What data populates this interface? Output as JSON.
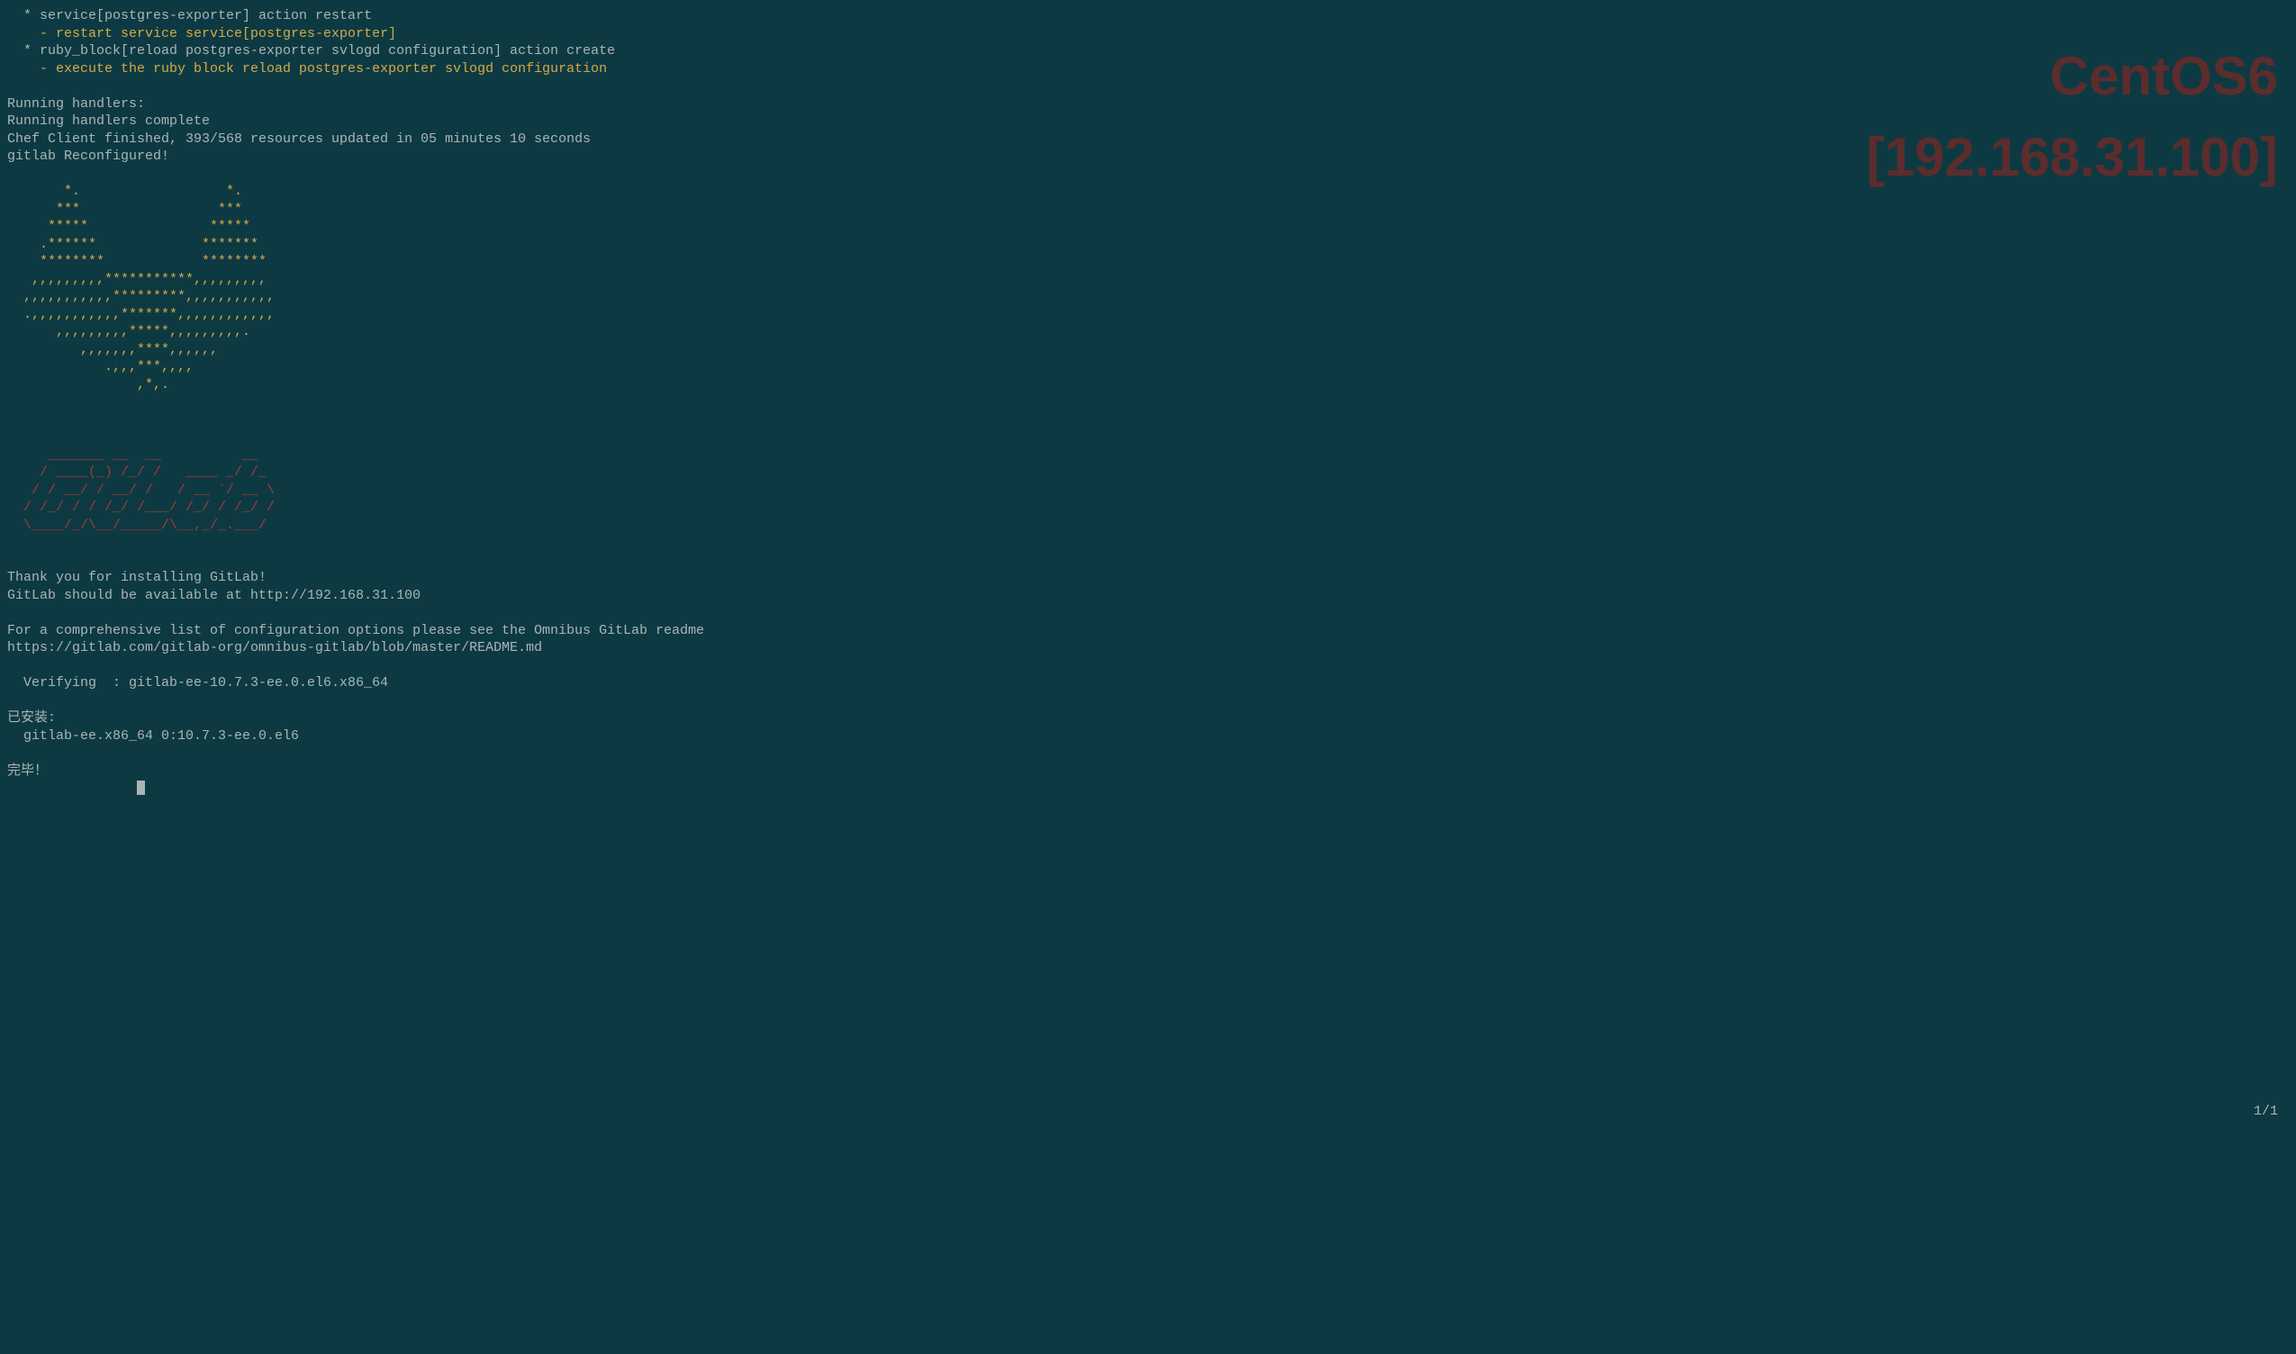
{
  "watermark": {
    "line1": "CentOS6",
    "line2": "[192.168.31.100]"
  },
  "ratio": "1/1",
  "lines": [
    {
      "cls": "gray",
      "text": "  * service[postgres-exporter] action restart"
    },
    {
      "cls": "yellow",
      "text": "    - restart service service[postgres-exporter]"
    },
    {
      "cls": "gray",
      "text": "  * ruby_block[reload postgres-exporter svlogd configuration] action create"
    },
    {
      "cls": "yellow",
      "text": "    - execute the ruby block reload postgres-exporter svlogd configuration"
    },
    {
      "cls": "gray",
      "text": ""
    },
    {
      "cls": "gray",
      "text": "Running handlers:"
    },
    {
      "cls": "gray",
      "text": "Running handlers complete"
    },
    {
      "cls": "gray",
      "text": "Chef Client finished, 393/568 resources updated in 05 minutes 10 seconds"
    },
    {
      "cls": "gray",
      "text": "gitlab Reconfigured!"
    },
    {
      "cls": "gray",
      "text": ""
    },
    {
      "cls": "yellow",
      "text": "       *.                  *."
    },
    {
      "cls": "yellow",
      "text": "      ***                 ***"
    },
    {
      "cls": "yellow",
      "text": "     *****               *****"
    },
    {
      "cls": "yellow",
      "text": "    .******             *******"
    },
    {
      "cls": "yellow",
      "text": "    ********            ********"
    },
    {
      "cls": "yellow",
      "text": "   ,,,,,,,,,***********,,,,,,,,,"
    },
    {
      "cls": "yellow",
      "text": "  ,,,,,,,,,,,*********,,,,,,,,,,,"
    },
    {
      "cls": "yellow",
      "text": "  .,,,,,,,,,,,*******,,,,,,,,,,,,"
    },
    {
      "cls": "yellow",
      "text": "      ,,,,,,,,,*****,,,,,,,,,."
    },
    {
      "cls": "yellow",
      "text": "         ,,,,,,,****,,,,,,"
    },
    {
      "cls": "yellow",
      "text": "            .,,,***,,,,"
    },
    {
      "cls": "yellow",
      "text": "                ,*,."
    },
    {
      "cls": "gray",
      "text": ""
    },
    {
      "cls": "gray",
      "text": ""
    },
    {
      "cls": "gray",
      "text": ""
    },
    {
      "cls": "red",
      "text": "     _______ __  __          __"
    },
    {
      "cls": "red",
      "text": "    / ____(_) /_/ /   ____ _/ /_"
    },
    {
      "cls": "red",
      "text": "   / / __/ / __/ /   / __ `/ __ \\"
    },
    {
      "cls": "red",
      "text": "  / /_/ / / /_/ /___/ /_/ / /_/ /"
    },
    {
      "cls": "red",
      "text": "  \\____/_/\\__/_____/\\__,_/_.___/"
    },
    {
      "cls": "gray",
      "text": ""
    },
    {
      "cls": "gray",
      "text": ""
    },
    {
      "cls": "gray",
      "text": "Thank you for installing GitLab!"
    },
    {
      "cls": "gray",
      "text": "GitLab should be available at http://192.168.31.100"
    },
    {
      "cls": "gray",
      "text": ""
    },
    {
      "cls": "gray",
      "text": "For a comprehensive list of configuration options please see the Omnibus GitLab readme"
    },
    {
      "cls": "gray",
      "text": "https://gitlab.com/gitlab-org/omnibus-gitlab/blob/master/README.md"
    },
    {
      "cls": "gray",
      "text": ""
    },
    {
      "cls": "gray",
      "text": "  Verifying  : gitlab-ee-10.7.3-ee.0.el6.x86_64"
    },
    {
      "cls": "gray",
      "text": ""
    },
    {
      "cls": "gray",
      "text": "已安装:"
    },
    {
      "cls": "gray",
      "text": "  gitlab-ee.x86_64 0:10.7.3-ee.0.el6"
    },
    {
      "cls": "gray",
      "text": ""
    },
    {
      "cls": "gray",
      "text": "完毕！"
    }
  ]
}
